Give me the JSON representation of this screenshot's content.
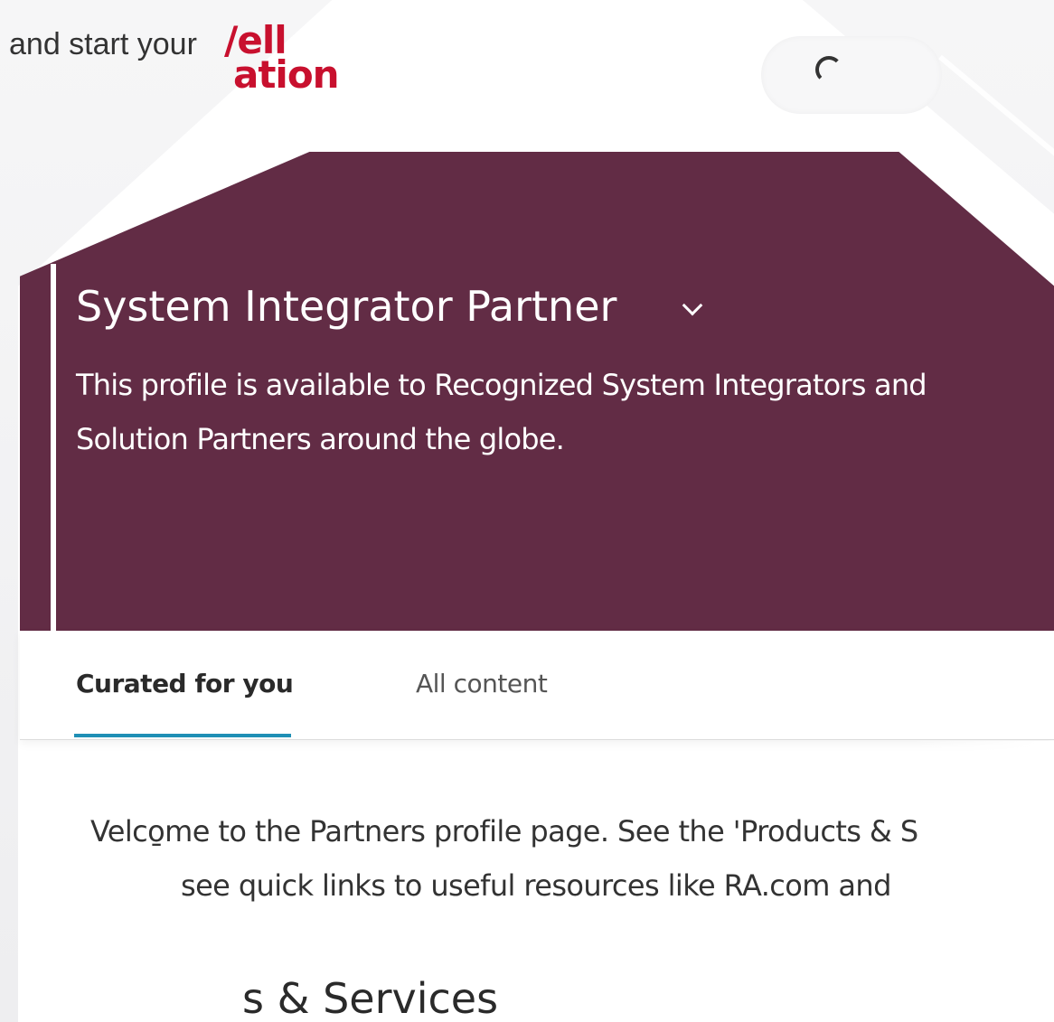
{
  "header": {
    "intro_text": "and start your",
    "logo_line1": "/ell",
    "logo_line2": "ation"
  },
  "hero": {
    "title": "System Integrator Partner",
    "description": "This profile is available to Recognized System Integrators and Solution Partners around the globe.",
    "background_color": "#622c45"
  },
  "tabs": [
    {
      "label": "Curated for you",
      "active": true
    },
    {
      "label": "All content",
      "active": false
    }
  ],
  "content": {
    "welcome_line1": "Velco̱me to the Partners profile page. See the 'Products & S",
    "welcome_line2": "see quick links to useful resources like RA.com and",
    "section_heading": "s & Services"
  },
  "colors": {
    "accent": "#1f8fb5",
    "brand": "#c8102e"
  }
}
